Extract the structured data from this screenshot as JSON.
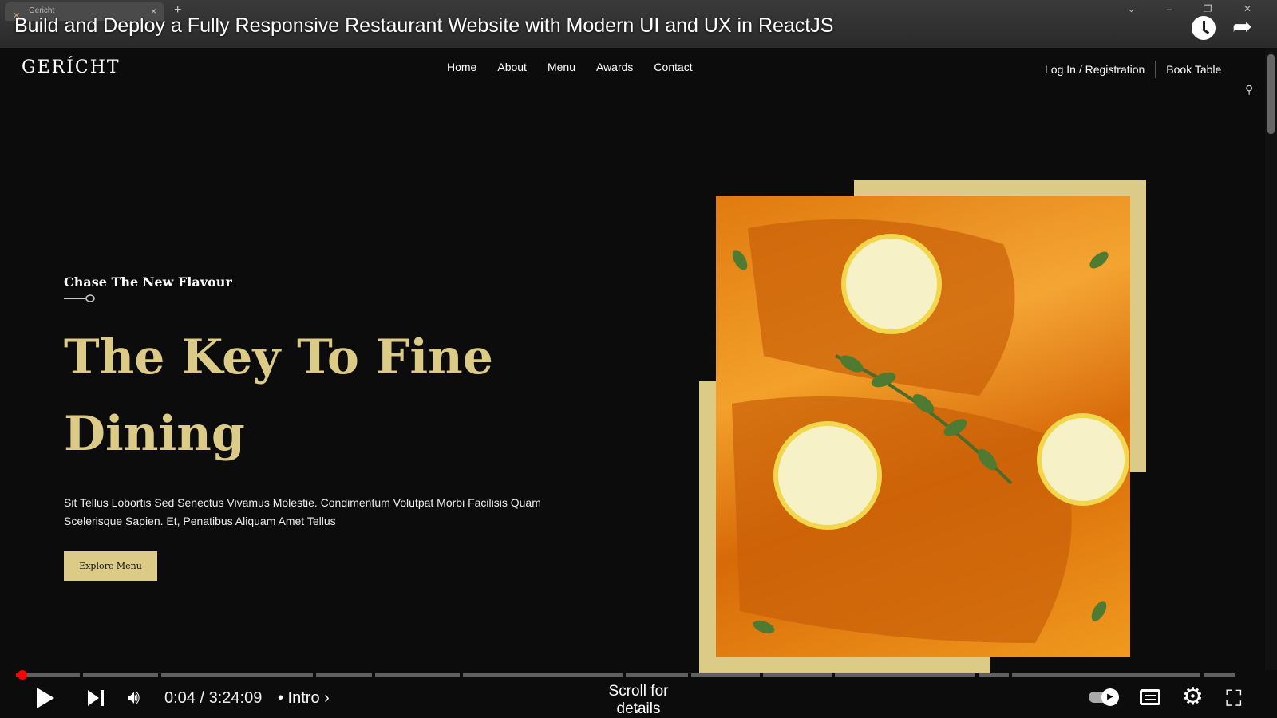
{
  "browser": {
    "tab_title": "Gericht",
    "tab_close": "×",
    "new_tab": "+",
    "window_controls": "⌄ – ❐ ✕"
  },
  "video": {
    "title": "Build and Deploy a Fully Responsive Restaurant Website with Modern UI and UX in ReactJS",
    "time": "0:04 / 3:24:09",
    "chapter": "• Intro ›",
    "scroll_hint": "Scroll for details",
    "progress_fraction": 0.0003
  },
  "site": {
    "logo": "GERÍCHT",
    "nav": [
      "Home",
      "About",
      "Menu",
      "Awards",
      "Contact"
    ],
    "login": "Log In / Registration",
    "book_table": "Book Table",
    "hero": {
      "subtitle": "Chase The New Flavour",
      "title": "The Key To Fine Dining",
      "description": "Sit Tellus Lobortis Sed Senectus Vivamus Molestie. Condimentum Volutpat Morbi Facilisis Quam Scelerisque Sapien. Et, Penatibus Aliquam Amet Tellus",
      "button": "Explore Menu"
    }
  },
  "colors": {
    "accent_gold": "#dcca87",
    "background": "#0c0c0c",
    "progress_red": "#ff0000"
  },
  "icons": {
    "watch_later": "clock-icon",
    "share": "share-icon",
    "play": "play-icon",
    "next": "next-icon",
    "volume": "volume-icon",
    "autoplay": "autoplay-toggle-icon",
    "captions": "captions-icon",
    "settings": "gear-icon",
    "fullscreen_exit": "fullscreen-exit-icon"
  }
}
